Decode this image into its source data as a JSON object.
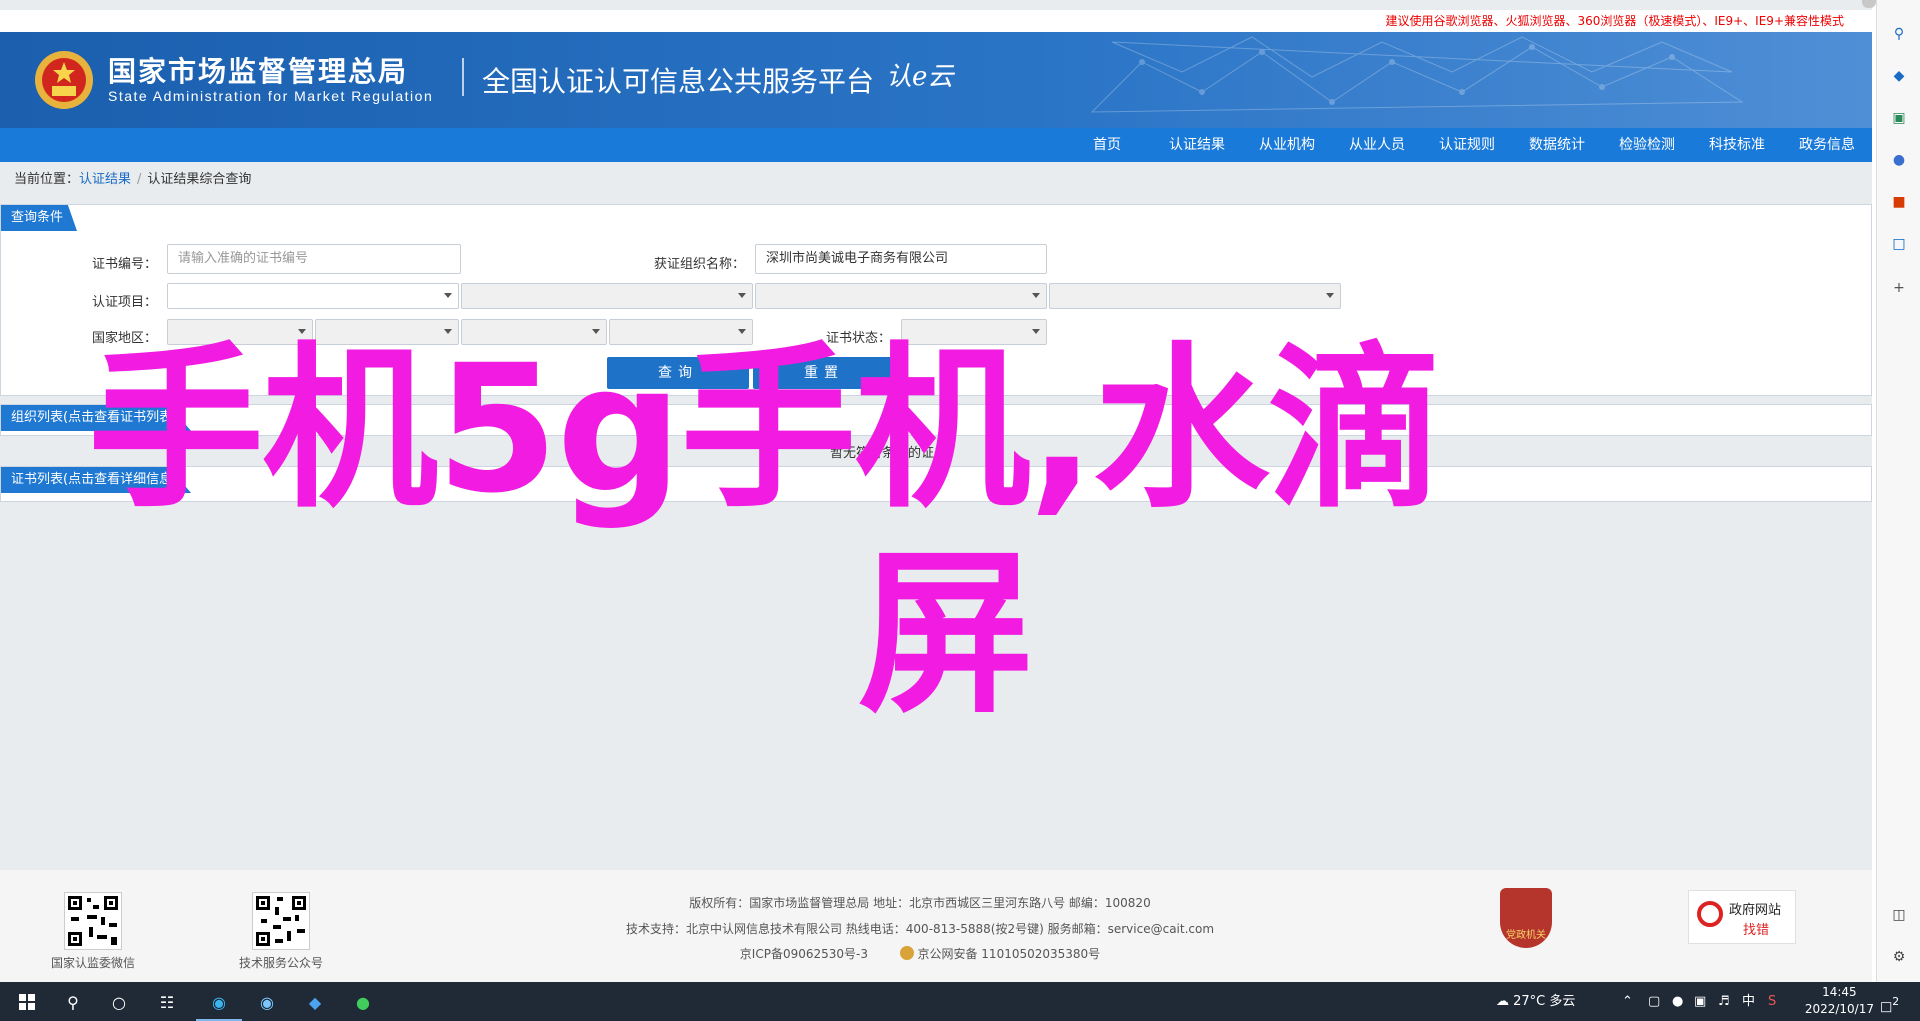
{
  "notice": "建议使用谷歌浏览器、火狐浏览器、360浏览器（极速模式）、IE9+、IE9+兼容性模式",
  "header": {
    "site_name_cn": "国家市场监督管理总局",
    "site_name_en": "State Administration  for  Market Regulation",
    "platform_title": "全国认证认可信息公共服务平台",
    "platform_logo_text": "认e云"
  },
  "nav": {
    "items": [
      "首页",
      "认证结果",
      "从业机构",
      "从业人员",
      "认证规则",
      "数据统计",
      "检验检测",
      "科技标准",
      "政务信息"
    ]
  },
  "breadcrumb": {
    "prefix": "当前位置：",
    "level1": "认证结果",
    "separator": "/",
    "level2": "认证结果综合查询"
  },
  "query_panel": {
    "tab_label": "查询条件",
    "cert_no_label": "证书编号：",
    "cert_no_placeholder": "请输入准确的证书编号",
    "org_label": "获证组织名称：",
    "org_value": "深圳市尚美诚电子商务有限公司",
    "project_label": "认证项目：",
    "region_label": "国家地区：",
    "status_label": "证书状态：",
    "search_button": "查询",
    "reset_button": "重置"
  },
  "org_panel": {
    "tab_label": "组织列表(点击查看证书列表)"
  },
  "cert_panel": {
    "tab_label": "证书列表(点击查看详细信息)",
    "empty_text": "暂无符合条件的证书!"
  },
  "footer": {
    "qr1_label": "国家认监委微信",
    "qr2_label": "技术服务公众号",
    "line1": "版权所有：国家市场监督管理总局    地址：北京市西城区三里河东路八号    邮编：100820",
    "line2": "技术支持：北京中认网信息技术有限公司    热线电话：400-813-5888(按2号键)    服务邮箱：service@cait.com",
    "icp": "京ICP备09062530号-3",
    "police_record": "京公网安备 11010502035380号",
    "party_badge": "党政机关",
    "gov_find_title": "政府网站",
    "gov_find_action": "找错"
  },
  "overlay": {
    "line1": "手机5g手机,水滴",
    "line2": "屏",
    "color": "#f21be1"
  },
  "taskbar": {
    "weather": "27°C  多云",
    "ime": "中",
    "time": "14:45",
    "date": "2022/10/17",
    "notification_count": "2"
  },
  "colors": {
    "header_blue": "#1b5fae",
    "nav_blue": "#1a7ad9",
    "button_blue": "#1e73c9",
    "overlay_magenta": "#f21be1"
  }
}
